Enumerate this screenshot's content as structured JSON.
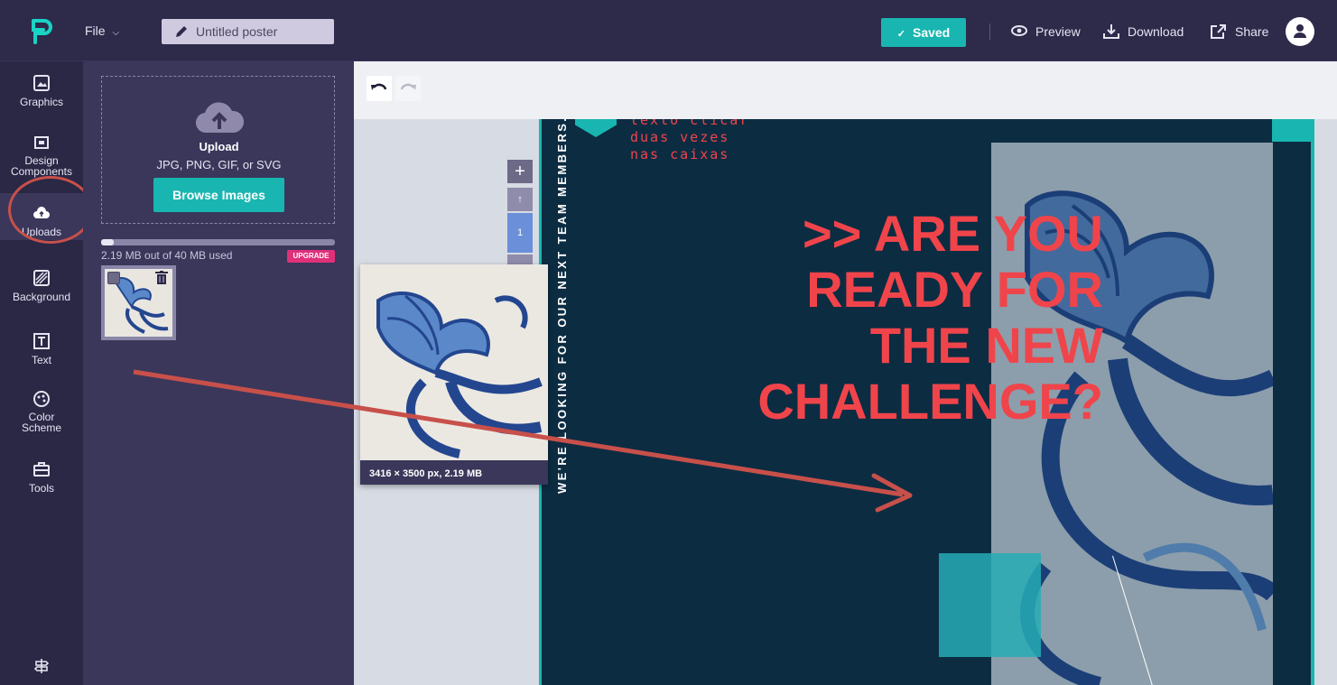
{
  "header": {
    "file_label": "File",
    "doc_title": "Untitled poster",
    "saved_label": "Saved",
    "preview_label": "Preview",
    "download_label": "Download",
    "share_label": "Share"
  },
  "rail": {
    "items": [
      {
        "label": "Graphics",
        "icon": "image-icon"
      },
      {
        "label": "Design Components",
        "icon": "components-icon"
      },
      {
        "label": "Uploads",
        "icon": "cloud-upload-icon"
      },
      {
        "label": "Background",
        "icon": "background-pattern-icon"
      },
      {
        "label": "Text",
        "icon": "text-icon"
      },
      {
        "label": "Color Scheme",
        "icon": "palette-icon"
      },
      {
        "label": "Tools",
        "icon": "toolbox-icon"
      }
    ],
    "active": "Uploads",
    "bottom_icon": "signpost-icon"
  },
  "uploads": {
    "title": "Upload",
    "types": "JPG, PNG, GIF, or SVG",
    "browse_label": "Browse Images",
    "usage_text": "2.19 MB out of 40 MB used",
    "usage_fraction": 0.055,
    "upgrade_label": "UPGRADE"
  },
  "page_controls": {
    "page_number": "1"
  },
  "drag_preview": {
    "meta": "3416 × 3500 px, 2.19 MB"
  },
  "poster": {
    "hint_lines": [
      "texto clicar",
      "duas vezes",
      "nas caixas"
    ],
    "headline_lines": [
      ">> ARE YOU",
      "READY FOR",
      "THE NEW",
      "CHALLENGE?"
    ],
    "vertical_text": "WE'RE LOOKING FOR OUR NEXT TEAM MEMBERS.",
    "colors": {
      "background": "#0c2c42",
      "accent": "#19b6b1",
      "headline": "#f0444b"
    }
  },
  "colors": {
    "topbar": "#2d2a4a",
    "brand": "#19b6b1",
    "upgrade": "#e0307a",
    "annotation": "#c8504a"
  }
}
